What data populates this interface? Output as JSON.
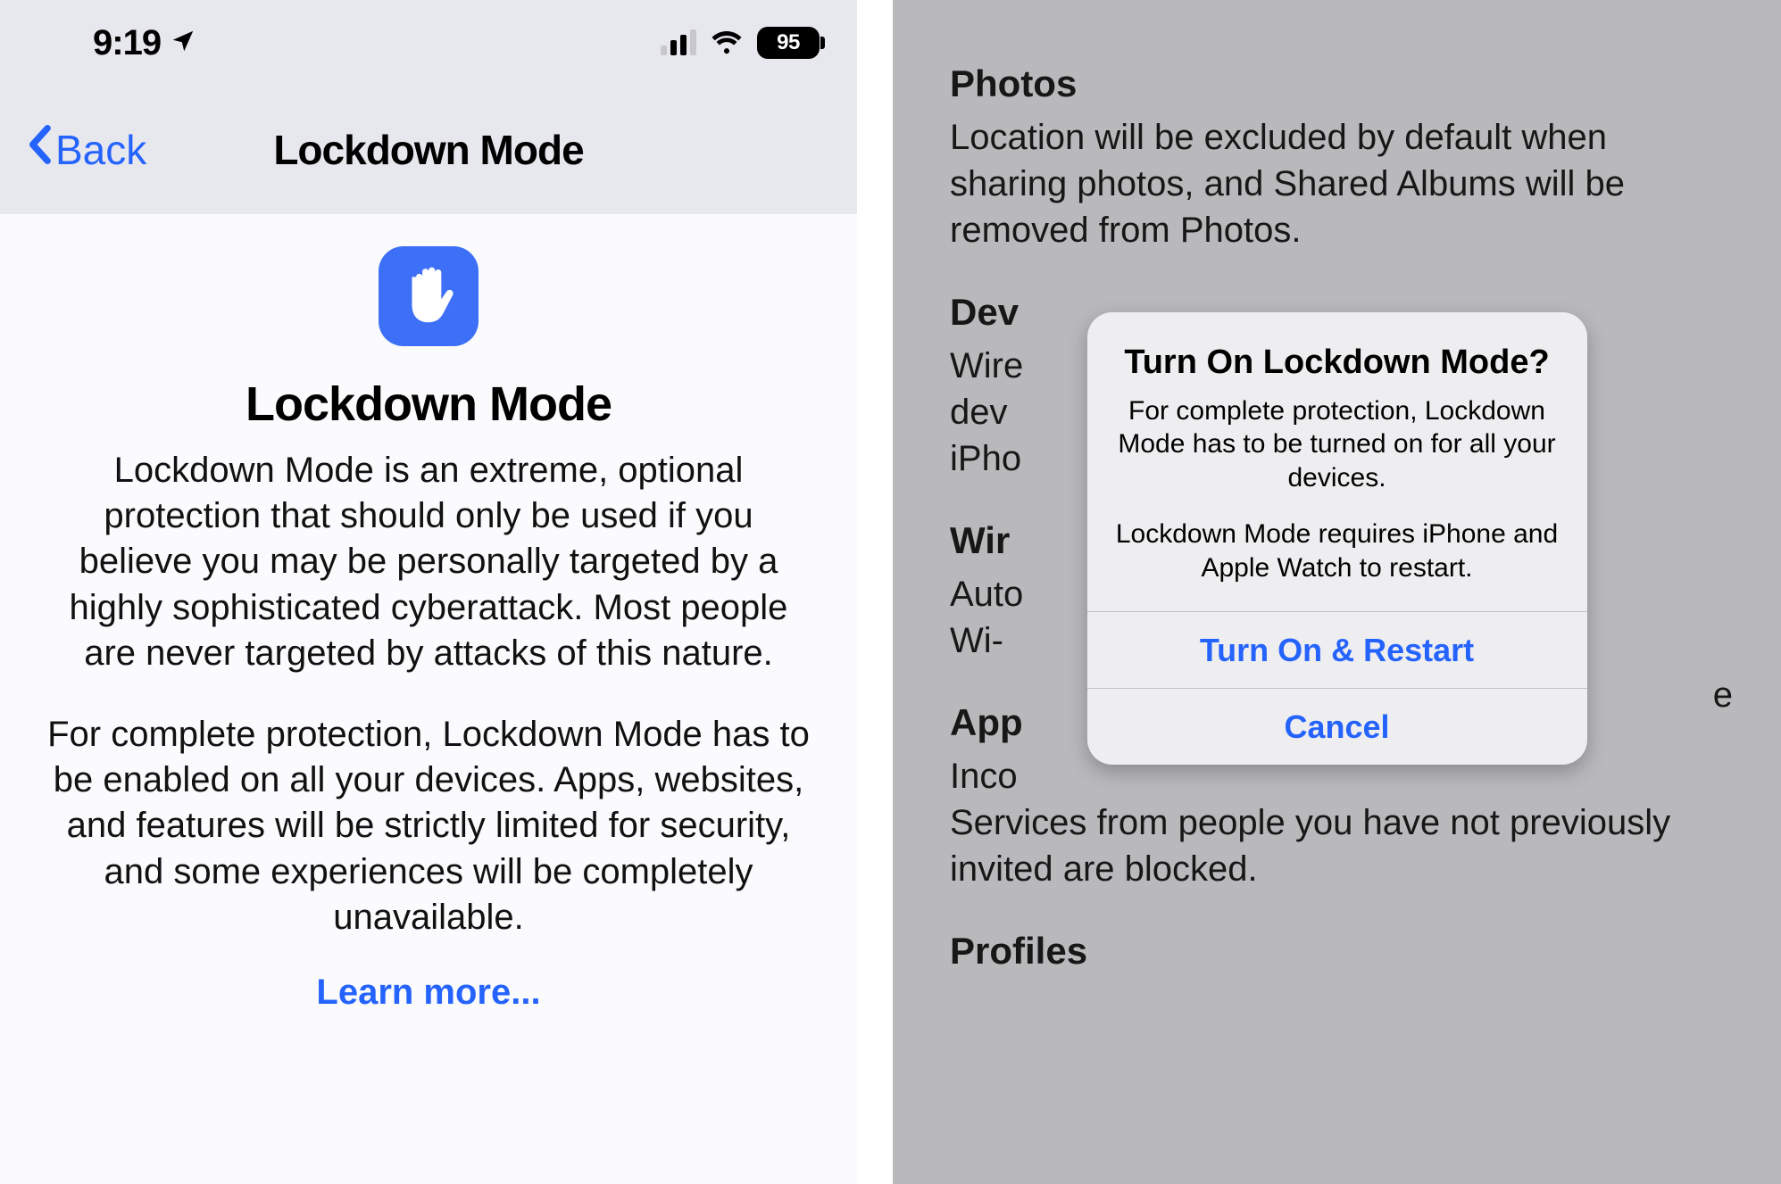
{
  "status": {
    "time": "9:19",
    "battery_pct": "95"
  },
  "nav": {
    "back_label": "Back",
    "title": "Lockdown Mode"
  },
  "left": {
    "heading": "Lockdown Mode",
    "para1": "Lockdown Mode is an extreme, optional protection that should only be used if you believe you may be personally targeted by a highly sophisticated cyberattack. Most people are never targeted by attacks of this nature.",
    "para2": "For complete protection, Lockdown Mode has to be enabled on all your devices. Apps, websites, and features will be strictly limited for security, and some experiences will be completely unavailable.",
    "learn_more": "Learn more..."
  },
  "right": {
    "sections": {
      "photos": {
        "h": "Photos",
        "body": "Location will be excluded by default when sharing photos, and Shared Albums will be removed from Photos."
      },
      "dev": {
        "h": "Dev",
        "body": "Wire\ndev\niPho"
      },
      "wir": {
        "h": "Wir",
        "body": "Auto\nWi-"
      },
      "app": {
        "h": "App",
        "body": "Inco\nServices from people you have not previously invited are blocked."
      },
      "profiles": {
        "h": "Profiles"
      }
    },
    "tail_e": "e"
  },
  "alert": {
    "title": "Turn On Lockdown Mode?",
    "text1": "For complete protection, Lockdown Mode has to be turned on for all your devices.",
    "text2": "Lockdown Mode requires iPhone and Apple Watch to restart.",
    "primary": "Turn On & Restart",
    "cancel": "Cancel"
  }
}
